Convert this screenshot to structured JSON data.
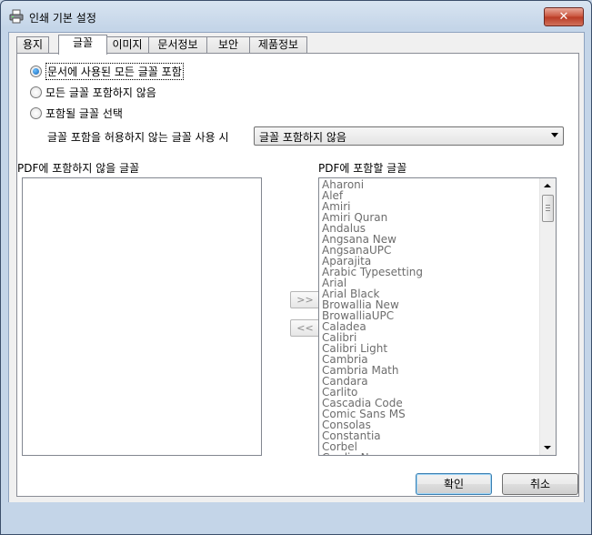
{
  "window": {
    "title": "인쇄 기본 설정",
    "close_glyph": "✕"
  },
  "tabs": [
    {
      "label": "용지",
      "active": false
    },
    {
      "label": "글꼴",
      "active": true
    },
    {
      "label": "이미지",
      "active": false
    },
    {
      "label": "문서정보",
      "active": false
    },
    {
      "label": "보안",
      "active": false
    },
    {
      "label": "제품정보",
      "active": false
    }
  ],
  "font_options": {
    "radio_embed_all": "문서에 사용된 모든 글꼴 포함",
    "radio_embed_none": "모든 글꼴 포함하지 않음",
    "radio_select": "포함될 글꼴 선택",
    "selected": "radio_embed_all",
    "non_embeddable_label": "글꼴 포함을 허용하지 않는 글꼴 사용 시",
    "non_embeddable_value": "글꼴 포함하지 않음"
  },
  "lists": {
    "exclude_label": "PDF에 포함하지 않을 글꼴",
    "include_label": "PDF에 포함할 글꼴",
    "exclude_items": [],
    "include_items": [
      "Aharoni",
      "Alef",
      "Amiri",
      "Amiri Quran",
      "Andalus",
      "Angsana New",
      "AngsanaUPC",
      "Aparajita",
      "Arabic Typesetting",
      "Arial",
      "Arial Black",
      "Browallia New",
      "BrowalliaUPC",
      "Caladea",
      "Calibri",
      "Calibri Light",
      "Cambria",
      "Cambria Math",
      "Candara",
      "Carlito",
      "Cascadia Code",
      "Comic Sans MS",
      "Consolas",
      "Constantia",
      "Corbel",
      "Cordia New"
    ]
  },
  "move_buttons": {
    "add": ">>",
    "remove": "<<"
  },
  "footer": {
    "ok": "확인",
    "cancel": "취소"
  }
}
